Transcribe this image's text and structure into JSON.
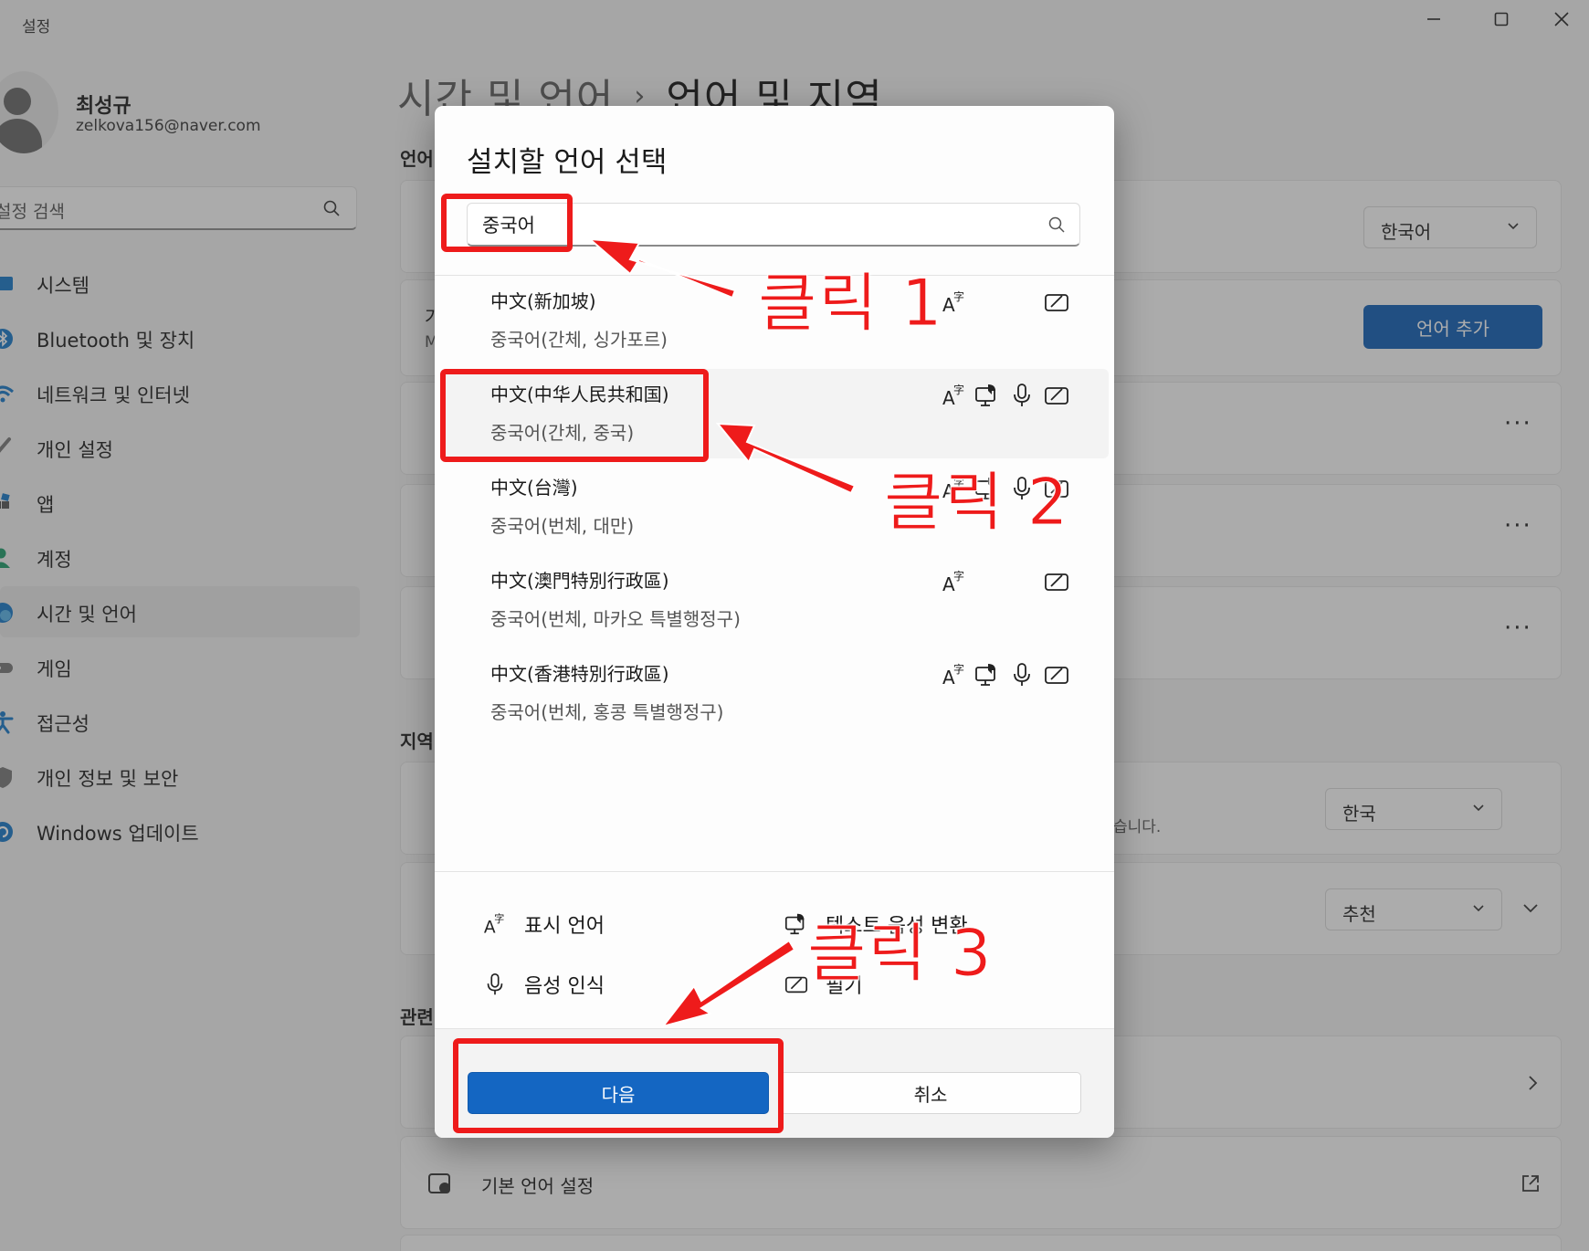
{
  "app": {
    "title": "설정",
    "user_name": "최성규",
    "user_email": "zelkova156@naver.com",
    "search_placeholder": "설정 검색"
  },
  "sidebar": {
    "items": [
      {
        "label": "시스템",
        "icon": "system-icon"
      },
      {
        "label": "Bluetooth 및 장치",
        "icon": "bluetooth-icon"
      },
      {
        "label": "네트워크 및 인터넷",
        "icon": "wifi-icon"
      },
      {
        "label": "개인 설정",
        "icon": "brush-icon"
      },
      {
        "label": "앱",
        "icon": "apps-icon"
      },
      {
        "label": "계정",
        "icon": "account-icon"
      },
      {
        "label": "시간 및 언어",
        "icon": "globe-clock-icon",
        "active": true
      },
      {
        "label": "게임",
        "icon": "gamepad-icon"
      },
      {
        "label": "접근성",
        "icon": "accessibility-icon"
      },
      {
        "label": "개인 정보 및 보안",
        "icon": "shield-icon"
      },
      {
        "label": "Windows 업데이트",
        "icon": "update-icon"
      }
    ]
  },
  "page": {
    "breadcrumb_parent": "시간 및 언어",
    "breadcrumb_separator": "›",
    "breadcrumb_current": "언어 및 지역",
    "section_language_partial": "언어",
    "section_region_partial": "지역",
    "section_related_partial": "관련",
    "display_language_value": "한국어",
    "add_language_button": "언어 추가",
    "card_partial_letter_1": "가",
    "card_partial_letter_2": "M",
    "more_options": "···",
    "region_country_value": "한국",
    "region_desc_partial": "습니다.",
    "regional_format_value": "추천",
    "admin_language_settings": "기본 언어 설정"
  },
  "dialog": {
    "title": "설치할 언어 선택",
    "search_value": "중국어",
    "languages": [
      {
        "native": "中文(新加坡)",
        "korean": "중국어(간체, 싱가포르)",
        "features": [
          "display",
          "handwriting"
        ]
      },
      {
        "native": "中文(中华人民共和国)",
        "korean": "중국어(간체, 중국)",
        "features": [
          "display",
          "tts",
          "speech",
          "handwriting"
        ],
        "selected": true
      },
      {
        "native": "中文(台灣)",
        "korean": "중국어(번체, 대만)",
        "features": [
          "display",
          "tts",
          "speech",
          "handwriting"
        ]
      },
      {
        "native": "中文(澳門特別行政區)",
        "korean": "중국어(번체, 마카오 특별행정구)",
        "features": [
          "display",
          "handwriting"
        ]
      },
      {
        "native": "中文(香港特別行政區)",
        "korean": "중국어(번체, 홍콩 특별행정구)",
        "features": [
          "display",
          "tts",
          "speech",
          "handwriting"
        ]
      }
    ],
    "legend": {
      "display": "표시 언어",
      "tts": "텍스트 음성 변환",
      "speech": "음성 인식",
      "handwriting": "필기"
    },
    "next_button": "다음",
    "cancel_button": "취소"
  },
  "annotations": {
    "step1": "클릭 1",
    "step2": "클릭 2",
    "step3": "클릭 3",
    "color": "#ee1b1b"
  },
  "colors": {
    "accent": "#1466c2",
    "dark_accent": "#0f5eb5",
    "annotation": "#ee1b1b"
  }
}
